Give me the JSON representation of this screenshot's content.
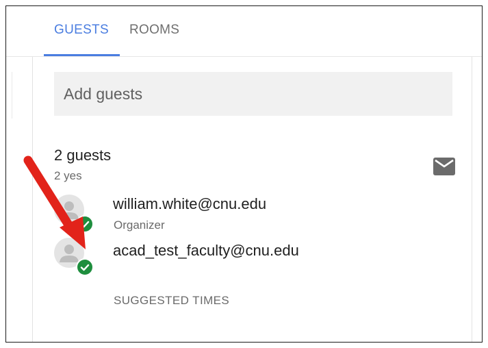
{
  "tabs": [
    {
      "label": "GUESTS",
      "active": true
    },
    {
      "label": "ROOMS",
      "active": false
    }
  ],
  "add_guests": {
    "placeholder": "Add guests"
  },
  "guest_summary": {
    "count_label": "2 guests",
    "yes_label": "2 yes"
  },
  "icons": {
    "mail": "mail-icon",
    "avatar": "person-icon",
    "status": "check-circle-icon",
    "annotation": "red-arrow"
  },
  "guests": [
    {
      "email": "william.white@cnu.edu",
      "role": "Organizer",
      "status": "accepted"
    },
    {
      "email": "acad_test_faculty@cnu.edu",
      "role": "",
      "status": "accepted"
    }
  ],
  "suggested_times_label": "SUGGESTED TIMES",
  "colors": {
    "accent": "#4a7de0",
    "accepted": "#1e8e3e",
    "arrow": "#e2231a",
    "field_bg": "#f1f1f1"
  }
}
